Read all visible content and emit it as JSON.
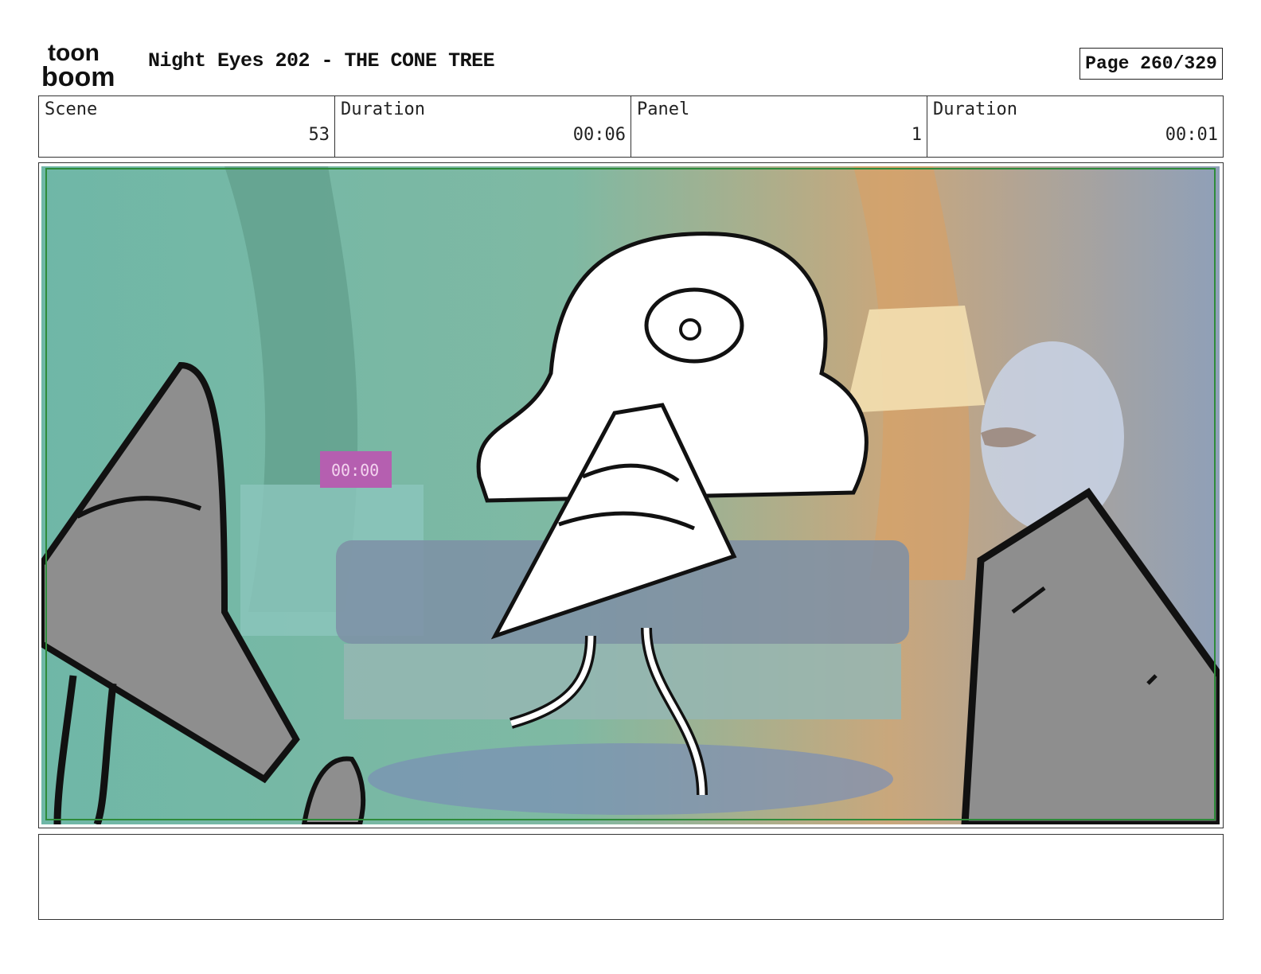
{
  "header": {
    "logo": {
      "line1": "toon",
      "line2": "boom"
    },
    "title": "Night Eyes 202 - THE CONE TREE",
    "page": "Page 260/329"
  },
  "info": [
    {
      "label": "Scene",
      "value": "53"
    },
    {
      "label": "Duration",
      "value": "00:06"
    },
    {
      "label": "Panel",
      "value": "1"
    },
    {
      "label": "Duration",
      "value": "00:01"
    }
  ],
  "panel": {
    "clock_display": "00:00",
    "colors": {
      "border": "#2e8b3a",
      "wall": "#5fa593",
      "warm_light": "#e8b46a",
      "cone": "#9a9a9a"
    }
  },
  "notes": {
    "text": ""
  }
}
